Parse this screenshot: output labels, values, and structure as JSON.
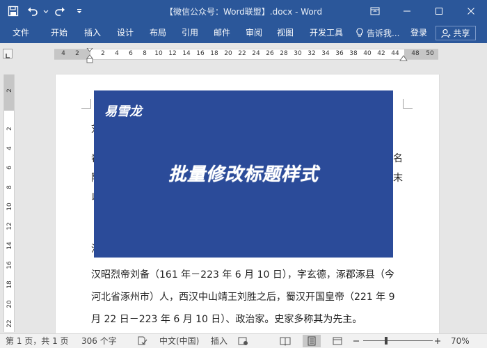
{
  "window": {
    "title": "【微信公众号：Word联盟】.docx - Word"
  },
  "ribbon": {
    "tabs": [
      {
        "label": "文件"
      },
      {
        "label": "开始"
      },
      {
        "label": "插入"
      },
      {
        "label": "设计"
      },
      {
        "label": "布局"
      },
      {
        "label": "引用"
      },
      {
        "label": "邮件"
      },
      {
        "label": "审阅"
      },
      {
        "label": "视图"
      },
      {
        "label": "开发工具"
      }
    ],
    "tell_me": "告诉我...",
    "login": "登录",
    "share": "共享"
  },
  "ruler": {
    "horizontal": [
      "4",
      "2",
      "2",
      "4",
      "6",
      "8",
      "10",
      "12",
      "14",
      "16",
      "18",
      "20",
      "22",
      "24",
      "26",
      "28",
      "30",
      "32",
      "34",
      "36",
      "38",
      "40",
      "42",
      "44",
      "48",
      "50"
    ],
    "vertical": [
      "2",
      "2",
      "4",
      "6",
      "8",
      "10",
      "12",
      "14",
      "16",
      "18",
      "20",
      "22"
    ]
  },
  "document": {
    "visible_fragments": {
      "left_1": "刘",
      "left_2": "舂",
      "left_3": "陸",
      "left_4": "以",
      "left_5": "汉",
      "right_1": "名",
      "right_2": "末"
    },
    "paragraph_lines": [
      "汉昭烈帝刘备（161 年－223 年 6 月 10 日），字玄德，涿郡涿县（今",
      "河北省涿州市）人，西汉中山靖王刘胜之后，蜀汉开国皇帝（221 年 9",
      "月 22 日－223 年 6 月 10 日）、政治家。史家多称其为先主。"
    ],
    "banner": {
      "brand": "易雪龙",
      "headline": "批量修改标题样式",
      "color": "#2b4b99"
    }
  },
  "statusbar": {
    "page": "第 1 页，共 1 页",
    "words": "306 个字",
    "language": "中文(中国)",
    "mode": "插入",
    "zoom": "70%",
    "zoom_level_percent": 70
  },
  "colors": {
    "accent": "#2b579a",
    "banner": "#2b4b99"
  }
}
